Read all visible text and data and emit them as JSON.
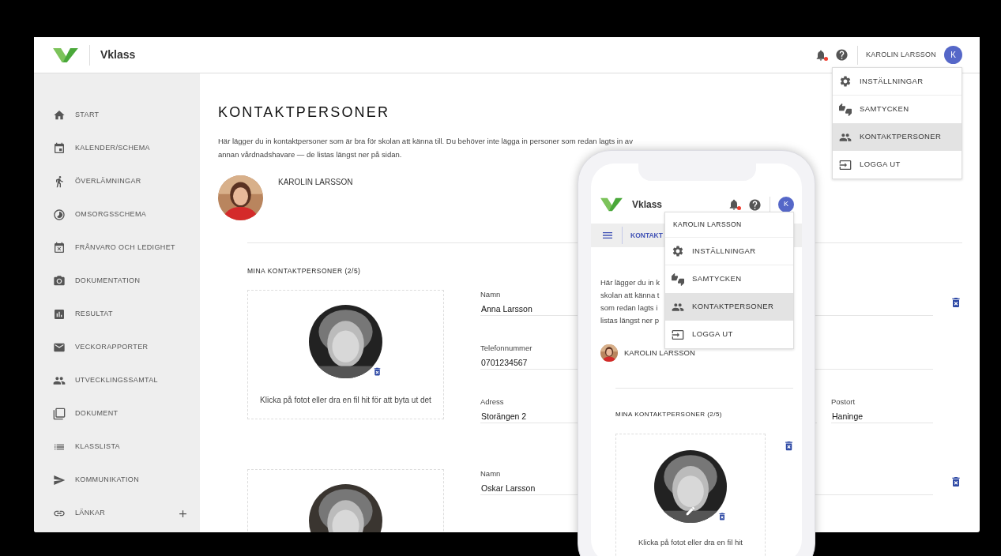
{
  "header": {
    "brand": "Vklass",
    "notification": true,
    "user_name": "KAROLIN LARSSON",
    "avatar_letter": "K"
  },
  "user_menu": {
    "items": [
      {
        "label": "INSTÄLLNINGAR",
        "selected": false
      },
      {
        "label": "SAMTYCKEN",
        "selected": false
      },
      {
        "label": "KONTAKTPERSONER",
        "selected": true
      },
      {
        "label": "LOGGA UT",
        "selected": false
      }
    ]
  },
  "sidebar": {
    "items": [
      {
        "label": "START",
        "kind": "link"
      },
      {
        "label": "KALENDER/SCHEMA",
        "kind": "link"
      },
      {
        "label": "ÖVERLÄMNINGAR",
        "kind": "link"
      },
      {
        "label": "OMSORGSSCHEMA",
        "kind": "link"
      },
      {
        "label": "FRÅNVARO OCH LEDIGHET",
        "kind": "link"
      },
      {
        "label": "DOKUMENTATION",
        "kind": "link"
      },
      {
        "label": "RESULTAT",
        "kind": "link"
      },
      {
        "label": "VECKORAPPORTER",
        "kind": "link"
      },
      {
        "label": "UTVECKLINGSSAMTAL",
        "kind": "link"
      },
      {
        "label": "DOKUMENT",
        "kind": "link"
      },
      {
        "label": "KLASSLISTA",
        "kind": "link"
      },
      {
        "label": "KOMMUNIKATION",
        "kind": "link"
      },
      {
        "label": "LÄNKAR",
        "kind": "group"
      }
    ]
  },
  "page": {
    "title": "KONTAKTPERSONER",
    "intro": "Här lägger du in kontaktpersoner som är bra för skolan att känna till. Du behöver inte lägga in personer som redan lagts in av\nannan vårdnadshavare — de listas längst ner på sidan.",
    "profile_name": "KAROLIN LARSSON",
    "contacts_heading": "MINA KONTAKTPERSONER (2/5)",
    "contacts": [
      {
        "photo_hint": "Klicka på fotot eller dra en fil hit för att byta ut det",
        "fields": [
          {
            "label": "Namn",
            "value": "Anna Larsson",
            "kind": "wide"
          },
          {
            "label": "Telefonnummer",
            "value": "0701234567",
            "kind": "wide"
          },
          {
            "label": "Adress",
            "value": "Storängen 2",
            "kind": "half"
          },
          {
            "label": "Postort",
            "value": "Haninge",
            "kind": "narrow"
          }
        ]
      },
      {
        "fields": [
          {
            "label": "Namn",
            "value": "Oskar Larsson",
            "kind": "wide"
          }
        ]
      }
    ]
  },
  "phone": {
    "brand": "Vklass",
    "notification": true,
    "avatar_letter": "K",
    "breadcrumb": "KONTAKT",
    "intro_lines": [
      "Här lägger du in k",
      "skolan att känna t",
      "som redan lagts i",
      "listas längst ner p"
    ],
    "profile_name": "KAROLIN LARSSON",
    "contacts_heading": "MINA KONTAKTPERSONER (2/5)",
    "photo_hint": "Klicka på fotot eller dra en fil hit",
    "menu": {
      "header": "KAROLIN LARSSON",
      "items": [
        {
          "label": "INSTÄLLNINGAR",
          "selected": false
        },
        {
          "label": "SAMTYCKEN",
          "selected": false
        },
        {
          "label": "KONTAKTPERSONER",
          "selected": true
        },
        {
          "label": "LOGGA UT",
          "selected": false
        }
      ]
    }
  }
}
